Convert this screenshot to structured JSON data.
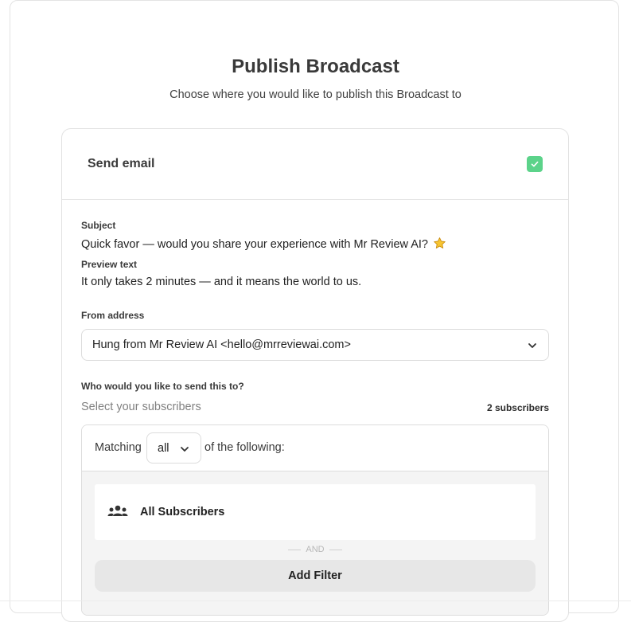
{
  "header": {
    "title": "Publish Broadcast",
    "subtitle": "Choose where you would like to publish this Broadcast to"
  },
  "email_card": {
    "label": "Send email",
    "checked": true,
    "accent_color": "#5cd38a"
  },
  "subject": {
    "label": "Subject",
    "value": "Quick favor — would you share your experience with Mr Review AI?",
    "emoji_icon": "star-icon"
  },
  "preview": {
    "label": "Preview text",
    "value": "It only takes 2 minutes — and it means the world to us."
  },
  "from_address": {
    "label": "From address",
    "selected": "Hung from Mr Review AI <hello@mrreviewai.com>"
  },
  "recipients": {
    "label": "Who would you like to send this to?",
    "placeholder": "Select your subscribers",
    "count": "2 subscribers",
    "matching_prefix": "Matching",
    "matching_value": "all",
    "matching_suffix": "of the following:",
    "segment_label": "All Subscribers",
    "and_label": "AND",
    "add_filter_label": "Add Filter"
  }
}
